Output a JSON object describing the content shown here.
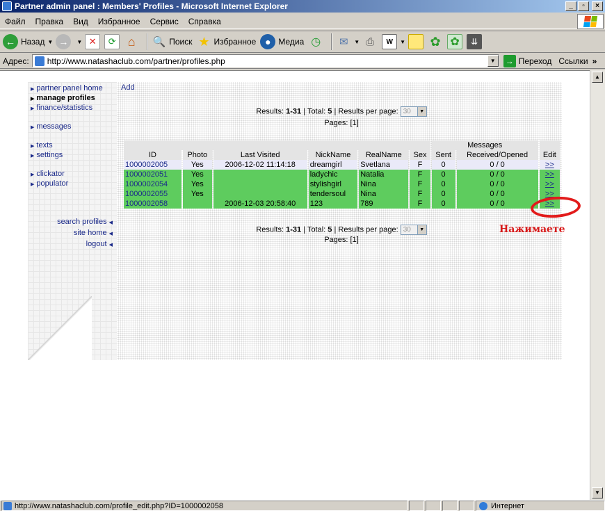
{
  "window": {
    "title": "Partner admin panel : Members' Profiles - Microsoft Internet Explorer",
    "minimize": "_",
    "maximize": "▫",
    "close": "×"
  },
  "menu": [
    "Файл",
    "Правка",
    "Вид",
    "Избранное",
    "Сервис",
    "Справка"
  ],
  "toolbar": {
    "back_label": "Назад",
    "search_label": "Поиск",
    "favorites_label": "Избранное",
    "media_label": "Медиа"
  },
  "address": {
    "label": "Адрес:",
    "url": "http://www.natashaclub.com/partner/profiles.php",
    "go_label": "Переход",
    "links_label": "Ссылки"
  },
  "sidebar": {
    "items": [
      {
        "label": "partner panel home",
        "active": false
      },
      {
        "label": "manage profiles",
        "active": true
      },
      {
        "label": "finance/statistics",
        "active": false
      },
      {
        "label": "messages",
        "active": false
      },
      {
        "label": "texts",
        "active": false
      },
      {
        "label": "settings",
        "active": false
      },
      {
        "label": "clickator",
        "active": false
      },
      {
        "label": "populator",
        "active": false
      }
    ],
    "bottom_links": [
      "search profiles",
      "site home",
      "logout"
    ]
  },
  "main": {
    "add_label": "Add",
    "results_label": "Results:",
    "results_range": "1-31",
    "total_label": "Total:",
    "total_value": "5",
    "per_page_label": "Results per page:",
    "per_page_value": "30",
    "pages_label": "Pages:",
    "pages_value": "[1]"
  },
  "table": {
    "group_header": "Messages",
    "columns": [
      "ID",
      "Photo",
      "Last Visited",
      "NickName",
      "RealName",
      "Sex",
      "Sent",
      "Received/Opened",
      "Edit"
    ],
    "rows": [
      {
        "id": "1000002005",
        "photo": "Yes",
        "last_visited": "2006-12-02 11:14:18",
        "nick": "dreamgirl",
        "real": "Svetlana",
        "sex": "F",
        "sent": "0",
        "received": "0 / 0",
        "edit": ">>",
        "style": "plain"
      },
      {
        "id": "1000002051",
        "photo": "Yes",
        "last_visited": "",
        "nick": "ladychic",
        "real": "Natalia",
        "sex": "F",
        "sent": "0",
        "received": "0 / 0",
        "edit": ">>",
        "style": "green"
      },
      {
        "id": "1000002054",
        "photo": "Yes",
        "last_visited": "",
        "nick": "stylishgirl",
        "real": "Nina",
        "sex": "F",
        "sent": "0",
        "received": "0 / 0",
        "edit": ">>",
        "style": "green"
      },
      {
        "id": "1000002055",
        "photo": "Yes",
        "last_visited": "",
        "nick": "tendersoul",
        "real": "Nina",
        "sex": "F",
        "sent": "0",
        "received": "0 / 0",
        "edit": ">>",
        "style": "green"
      },
      {
        "id": "1000002058",
        "photo": "",
        "last_visited": "2006-12-03 20:58:40",
        "nick": "123",
        "real": "789",
        "sex": "F",
        "sent": "0",
        "received": "0 / 0",
        "edit": ">>",
        "style": "green"
      }
    ]
  },
  "annotation": {
    "text": "Нажимаете",
    "color": "#d81818"
  },
  "status": {
    "url": "http://www.natashaclub.com/profile_edit.php?ID=1000002058",
    "zone": "Интернет"
  },
  "colors": {
    "row_green": "#5ecc5e",
    "row_plain": "#eaeaf8",
    "link": "#1b2a8a"
  }
}
